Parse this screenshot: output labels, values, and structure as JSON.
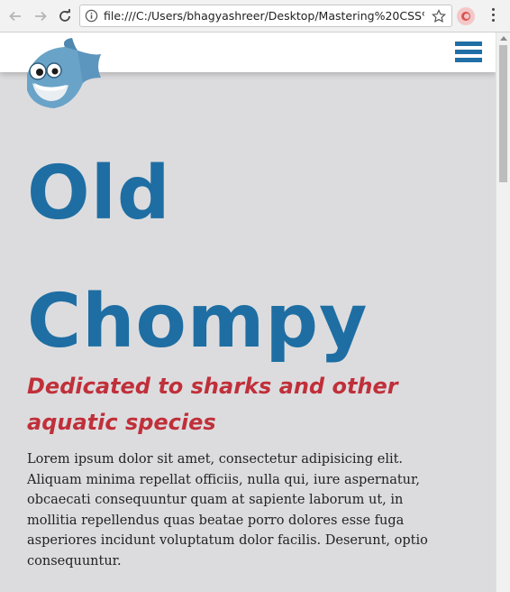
{
  "browser": {
    "url": "file:///C:/Users/bhagyashreer/Desktop/Mastering%20CSS%",
    "icons": [
      "back-arrow-icon",
      "forward-arrow-icon",
      "reload-icon",
      "info-icon",
      "star-icon",
      "extension-icon",
      "menu-dots-icon"
    ]
  },
  "page": {
    "logo_name": "shark-logo",
    "menu_icon": "hamburger-menu-icon",
    "title": "Old Chompy",
    "subtitle": "Dedicated to sharks and other aquatic species",
    "body": "Lorem ipsum dolor sit amet, consectetur adipisicing elit. Aliquam minima repellat officiis, nulla qui, iure aspernatur, obcaecati consequuntur quam at sapiente laborum ut, in mollitia repellendus quas beatae porro dolores esse fuga asperiores incidunt voluptatum dolor facilis. Deserunt, optio consequuntur."
  },
  "colors": {
    "title": "#1e6ea3",
    "subtitle": "#c0303a",
    "menu": "#1f6fa6",
    "content_bg": "#dcdcde"
  }
}
